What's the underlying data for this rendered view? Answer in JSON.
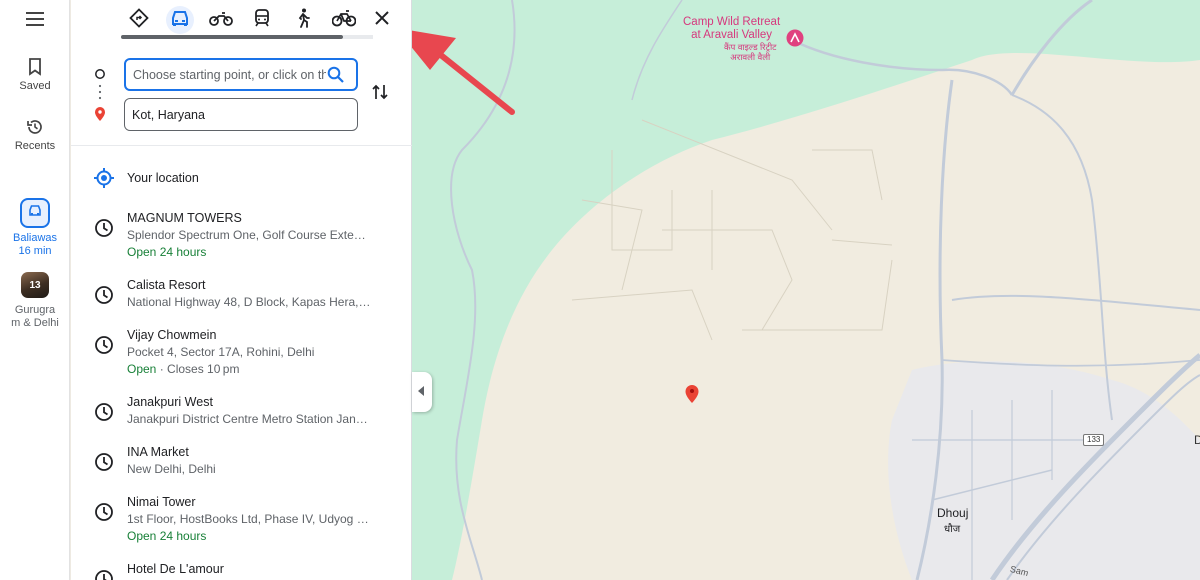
{
  "rail": {
    "menu_icon": "menu-icon",
    "saved_label": "Saved",
    "recents_label": "Recents",
    "trip": {
      "line1": "Baliawas",
      "line2": "16 min"
    },
    "photo": {
      "badge": "13",
      "line1": "Gurugra",
      "line2": "m & Delhi"
    }
  },
  "modes": [
    {
      "name": "best-route",
      "icon": "directions-diamond-icon",
      "active": false
    },
    {
      "name": "driving",
      "icon": "car-icon",
      "active": true
    },
    {
      "name": "two-wheeler",
      "icon": "motorbike-icon",
      "active": false
    },
    {
      "name": "transit",
      "icon": "train-icon",
      "active": false
    },
    {
      "name": "walking",
      "icon": "walk-icon",
      "active": false
    },
    {
      "name": "cycling",
      "icon": "bicycle-icon",
      "active": false
    }
  ],
  "directions": {
    "start_placeholder": "Choose starting point, or click on th",
    "destination_value": "Kot, Haryana"
  },
  "suggestions": [
    {
      "name": "Your location",
      "icon": "my-location-icon"
    },
    {
      "name": "MAGNUM TOWERS",
      "address": "Splendor Spectrum One, Golf Course Exte…",
      "hours": "Open 24 hours",
      "icon": "history-icon"
    },
    {
      "name": "Calista Resort",
      "address": "National Highway 48, D Block, Kapas Hera, …",
      "icon": "history-icon"
    },
    {
      "name": "Vijay Chowmein",
      "address": "Pocket 4, Sector 17A, Rohini, Delhi",
      "hours": "Open",
      "hours_rest": " · Closes 10 pm",
      "icon": "history-icon"
    },
    {
      "name": "Janakpuri West",
      "address": "Janakpuri District Centre Metro Station Jan…",
      "icon": "history-icon"
    },
    {
      "name": "INA Market",
      "address": "New Delhi, Delhi",
      "icon": "history-icon"
    },
    {
      "name": "Nimai Tower",
      "address": "1st Floor, HostBooks Ltd, Phase IV, Udyog V…",
      "hours": "Open 24 hours",
      "icon": "history-icon"
    },
    {
      "name": "Hotel De L'amour",
      "icon": "history-icon"
    }
  ],
  "map": {
    "poi_line1": "Camp Wild Retreat",
    "poi_line2": "at Aravali Valley",
    "poi_hindi1": "कैंप वाइल्ड रिट्रीट",
    "poi_hindi2": "अरावली वैली",
    "town": "Dhouj",
    "town_hindi": "धौज",
    "highway_shield": "133",
    "edge_letter": "D",
    "road_partial": "Sam",
    "colors": {
      "forest": "#c6eed9",
      "land": "#f1ece0",
      "urban": "#e9e9ec",
      "road": "#c2cbd9",
      "pin": "#ea4335",
      "annotation_arrow": "#e8474f"
    }
  }
}
